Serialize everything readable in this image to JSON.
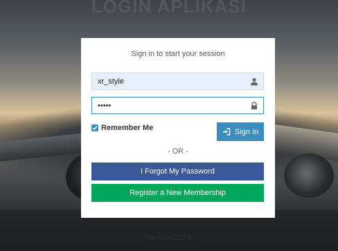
{
  "page": {
    "title": "LOGIN APLIKASI",
    "version": "Version 2.0.0"
  },
  "login": {
    "message": "Sign in to start your session",
    "username": {
      "value": "xr_style",
      "icon": "user-icon"
    },
    "password": {
      "value": "12345",
      "icon": "lock-icon"
    },
    "remember_label": "Remember Me",
    "remember_checked": true,
    "signin_label": "Sign In",
    "signin_icon": "sign-in-icon",
    "or_text": "- OR -",
    "forgot_label": "I Forgot My Password",
    "register_label": "Register a New Membership"
  },
  "colors": {
    "primary": "#3c8dbc",
    "facebook_blue": "#3b5998",
    "success_green": "#00a65a"
  }
}
